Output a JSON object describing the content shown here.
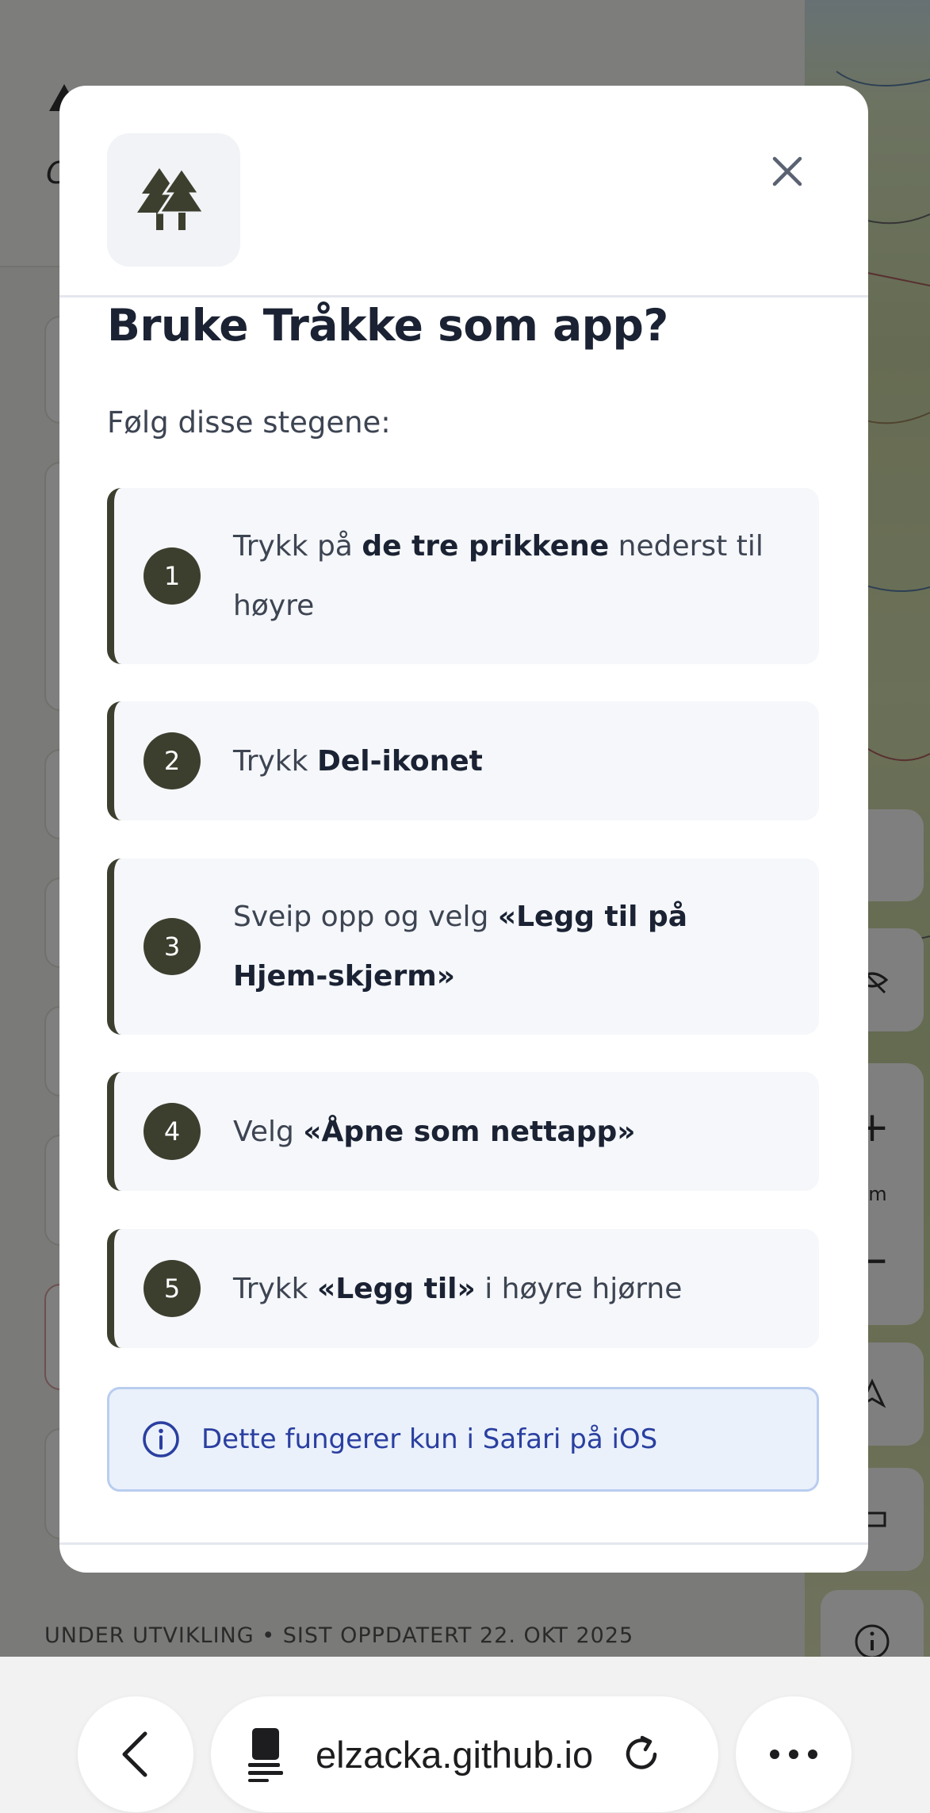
{
  "background": {
    "footer_text": "UNDER UTVIKLING • SIST OPPDATERT 22. OKT 2025",
    "map_scale_label": "km"
  },
  "modal": {
    "title": "Bruke Tråkke som app?",
    "intro": "Følg disse stegene:",
    "steps": [
      {
        "num": "1",
        "pre": "Trykk på ",
        "bold": "de tre prikkene",
        "post": " nederst til høyre"
      },
      {
        "num": "2",
        "pre": "Trykk ",
        "bold": "Del-ikonet",
        "post": ""
      },
      {
        "num": "3",
        "pre": "Sveip opp og velg ",
        "bold": "«Legg til på Hjem-skjerm»",
        "post": ""
      },
      {
        "num": "4",
        "pre": "Velg ",
        "bold": "«Åpne som nettapp»",
        "post": ""
      },
      {
        "num": "5",
        "pre": "Trykk ",
        "bold": "«Legg til»",
        "post": " i høyre hjørne"
      }
    ],
    "info": "Dette fungerer kun i Safari på iOS"
  },
  "browser": {
    "url": "elzacka.github.io"
  },
  "colors": {
    "accent": "#3c3f2e",
    "info_text": "#2a3fa0",
    "info_bg": "#eaf1fb"
  },
  "icons": [
    "tree-logo-icon",
    "close-icon",
    "info-icon",
    "back-icon",
    "page-menu-icon",
    "reload-icon",
    "more-icon",
    "location-icon",
    "ruler-icon",
    "eye-off-icon"
  ]
}
